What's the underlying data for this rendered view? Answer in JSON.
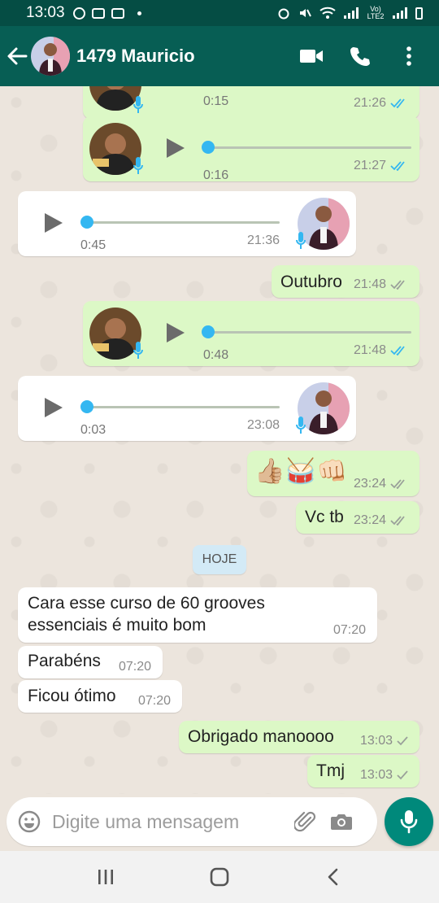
{
  "status": {
    "time": "13:03",
    "network": "Vo) LTE2"
  },
  "header": {
    "contact_name": "1479 Mauricio"
  },
  "messages": {
    "v1": {
      "duration": "0:15",
      "time": "21:26"
    },
    "v2": {
      "duration": "0:16",
      "time": "21:27"
    },
    "v3": {
      "duration": "0:45",
      "time": "21:36"
    },
    "t1": {
      "text": "Outubro",
      "time": "21:48"
    },
    "v4": {
      "duration": "0:48",
      "time": "21:48"
    },
    "v5": {
      "duration": "0:03",
      "time": "23:08"
    },
    "e1": {
      "text": "👍🏼🥁👊🏻",
      "time": "23:24"
    },
    "t2": {
      "text": "Vc tb",
      "time": "23:24"
    },
    "date_chip": "HOJE",
    "t3": {
      "line1": "Cara esse curso de 60 grooves",
      "line2": "essenciais é muito bom",
      "time": "07:20"
    },
    "t4": {
      "text": "Parabéns",
      "time": "07:20"
    },
    "t5": {
      "text": "Ficou ótimo",
      "time": "07:20"
    },
    "t6": {
      "text": "Obrigado manoooo",
      "time": "13:03"
    },
    "t7": {
      "text": "Tmj",
      "time": "13:03"
    }
  },
  "composer": {
    "placeholder": "Digite uma mensagem"
  },
  "colors": {
    "header": "#075e54",
    "outgoing": "#dcf8c6",
    "incoming": "#ffffff",
    "read_tick": "#34b7f1",
    "fab": "#00897b"
  }
}
